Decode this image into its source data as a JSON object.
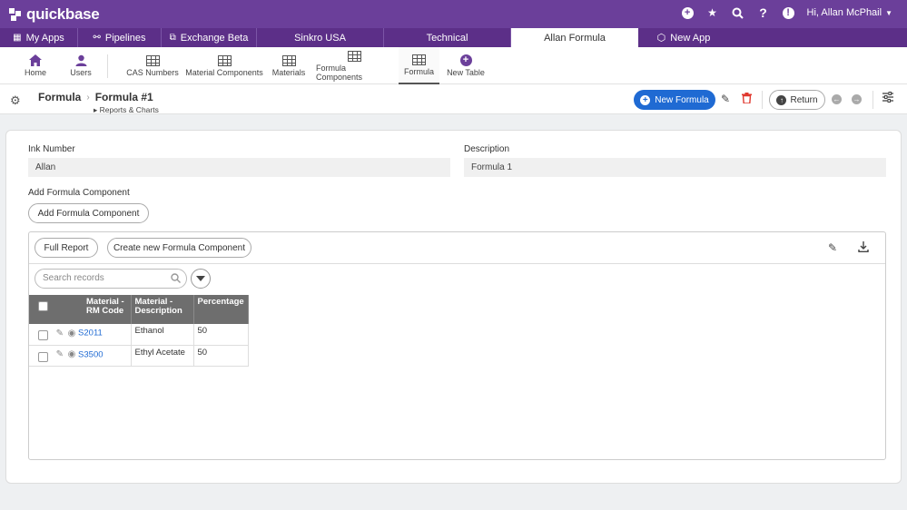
{
  "brand": {
    "name": "quickbase"
  },
  "topbar": {
    "user_greeting": "Hi, Allan McPhail"
  },
  "app_tabs": [
    {
      "label": "My Apps",
      "icon": "grid-icon"
    },
    {
      "label": "Pipelines",
      "icon": "pipelines-icon"
    },
    {
      "label": "Exchange Beta",
      "icon": "exchange-icon"
    },
    {
      "label": "Sinkro USA"
    },
    {
      "label": "Technical"
    },
    {
      "label": "Allan Formula",
      "active": true
    },
    {
      "label": "New App",
      "icon": "cube-icon"
    }
  ],
  "table_bar": {
    "home": "Home",
    "users": "Users",
    "tables": [
      "CAS Numbers",
      "Material Components",
      "Materials",
      "Formula Components",
      "Formula"
    ],
    "active": "Formula",
    "new_table": "New Table"
  },
  "record_header": {
    "breadcrumb_table": "Formula",
    "breadcrumb_record": "Formula #1",
    "reports_link": "Reports & Charts",
    "new_button": "New Formula",
    "return_button": "Return"
  },
  "form": {
    "ink_number_label": "Ink Number",
    "ink_number_value": "Allan",
    "description_label": "Description",
    "description_value": "Formula 1",
    "add_component_label": "Add Formula Component",
    "add_component_button": "Add Formula Component"
  },
  "embedded_report": {
    "full_report_button": "Full Report",
    "create_button": "Create new Formula Component",
    "search_placeholder": "Search records",
    "columns": [
      "Material - RM Code",
      "Material - Description",
      "Percentage"
    ],
    "rows": [
      {
        "code": "S2011",
        "description": "Ethanol",
        "percentage": "50"
      },
      {
        "code": "S3500",
        "description": "Ethyl Acetate",
        "percentage": "50"
      }
    ]
  },
  "colors": {
    "brand": "#6b3f9a",
    "app_tabs": "#5c2f88",
    "primary_button": "#1f6ad3",
    "delete": "#e0382f",
    "link": "#1f6ad3"
  }
}
